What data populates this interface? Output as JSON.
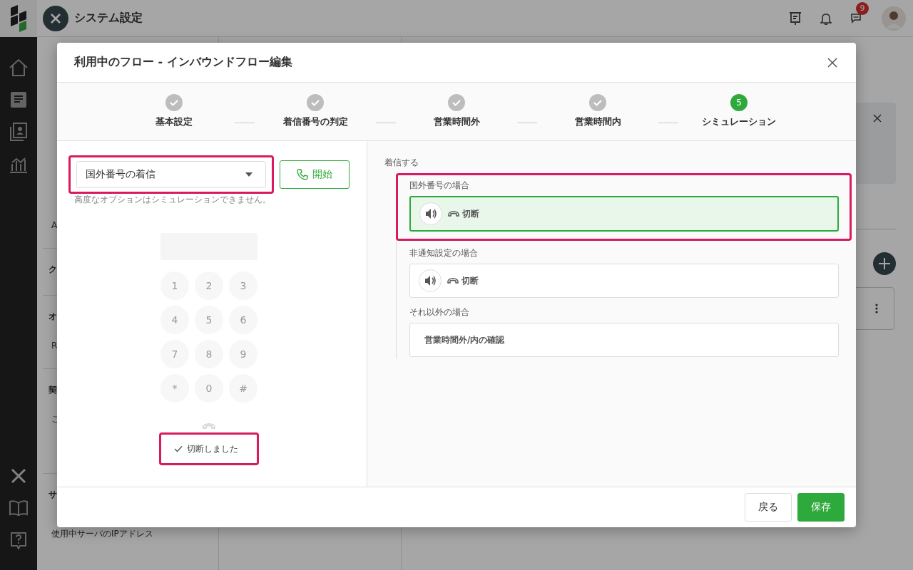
{
  "app_header": {
    "title": "システム設定",
    "notification_count": "9"
  },
  "settings_menu": [
    {
      "kind": "item",
      "label": "A"
    },
    {
      "kind": "section",
      "label": "ク"
    },
    {
      "kind": "section",
      "label": "オ"
    },
    {
      "kind": "item",
      "label": "R"
    },
    {
      "kind": "section",
      "label": "契"
    },
    {
      "kind": "item",
      "label": "こ"
    },
    {
      "kind": "section",
      "label": "サ"
    },
    {
      "kind": "item",
      "label": "使用中サーバのIPアドレス"
    }
  ],
  "dialog": {
    "title": "利用中のフロー - インバウンドフロー編集",
    "steps": [
      {
        "label": "基本設定",
        "done": true
      },
      {
        "label": "着信番号の判定",
        "done": true
      },
      {
        "label": "営業時間外",
        "done": true
      },
      {
        "label": "営業時間内",
        "done": true
      },
      {
        "label": "シミュレーション",
        "done": false,
        "number": "5"
      }
    ],
    "simulation": {
      "scenario": "国外番号の着信",
      "scenario_highlighted": true,
      "start_button": "開始",
      "note": "高度なオプションはシミュレーションできません。",
      "keypad": [
        "1",
        "2",
        "3",
        "4",
        "5",
        "6",
        "7",
        "8",
        "9",
        "*",
        "0",
        "#"
      ],
      "status": "切断しました",
      "status_highlighted": true
    },
    "flow": {
      "root": "着信する",
      "branches": [
        {
          "condition": "国外番号の場合",
          "kind": "hangup",
          "action": "切断",
          "active": true
        },
        {
          "condition": "非通知設定の場合",
          "kind": "hangup",
          "action": "切断",
          "active": false
        },
        {
          "condition": "それ以外の場合",
          "kind": "check",
          "action": "営業時間外/内の確認",
          "active": false
        }
      ]
    },
    "buttons": [
      {
        "label": "戻る",
        "kind": "secondary"
      },
      {
        "label": "保存",
        "kind": "primary"
      }
    ]
  }
}
